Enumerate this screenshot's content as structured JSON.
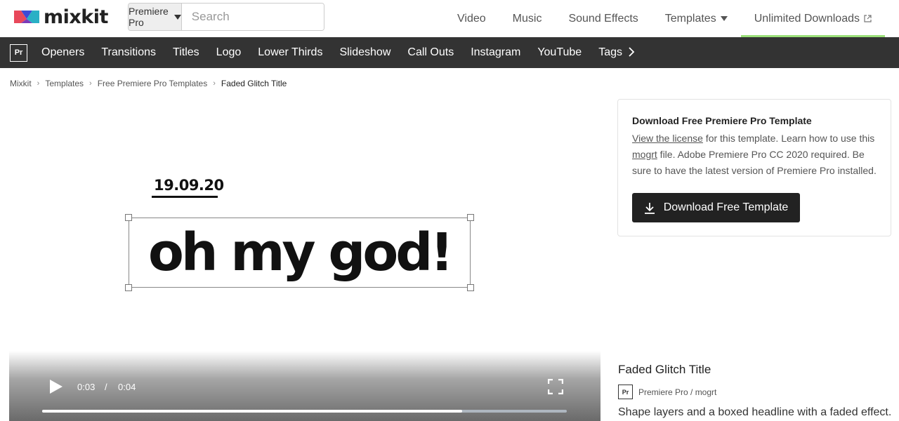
{
  "header": {
    "logo_text": "mixkit",
    "search": {
      "category": "Premiere Pro",
      "placeholder": "Search"
    },
    "nav": [
      {
        "label": "Video"
      },
      {
        "label": "Music"
      },
      {
        "label": "Sound Effects"
      },
      {
        "label": "Templates"
      },
      {
        "label": "Unlimited Downloads"
      }
    ]
  },
  "catbar": {
    "badge": "Pr",
    "items": [
      "Openers",
      "Transitions",
      "Titles",
      "Logo",
      "Lower Thirds",
      "Slideshow",
      "Call Outs",
      "Instagram",
      "YouTube",
      "Tags"
    ],
    "more_icon": "chevron-right-icon"
  },
  "breadcrumb": [
    "Mixkit",
    "Templates",
    "Free Premiere Pro Templates",
    "Faded Glitch Title"
  ],
  "preview": {
    "date": "19.09.20",
    "headline": "oh my god!",
    "current_time": "0:03",
    "separator": "/",
    "duration": "0:04",
    "progress": 0.8
  },
  "download_card": {
    "title": "Download Free Premiere Pro Template",
    "link_license": "View the license",
    "text_1": " for this template. Learn how to use this ",
    "link_mogrt": "mogrt",
    "text_2": " file. Adobe Premiere Pro CC 2020 required. Be sure to have the latest version of Premiere Pro installed.",
    "button_label": "Download Free Template"
  },
  "info": {
    "title": "Faded Glitch Title",
    "badge": "Pr",
    "meta": "Premiere Pro / mogrt",
    "description": "Shape layers and a boxed headline with a faded effect."
  },
  "colors": {
    "catbar_bg": "#333333",
    "accent_underline": "#9be07a",
    "button_bg": "#222222"
  }
}
